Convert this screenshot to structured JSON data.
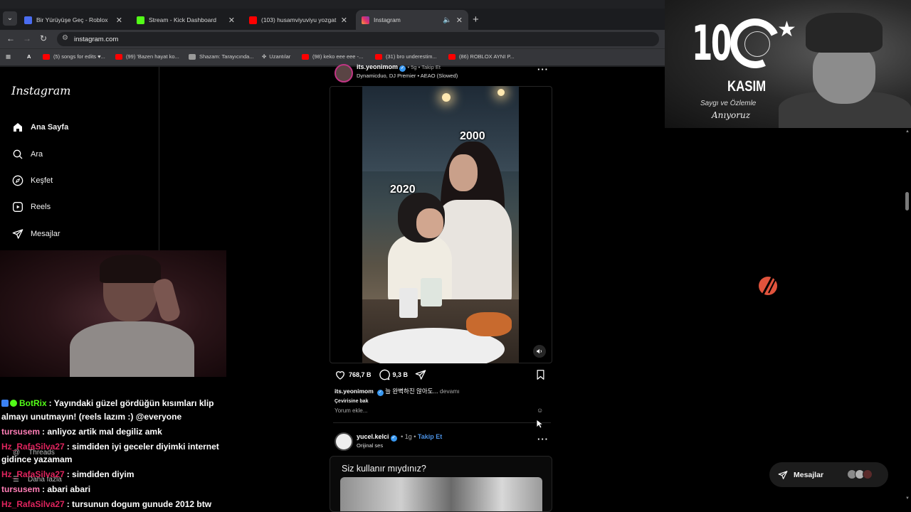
{
  "browser": {
    "tabs": [
      {
        "title": "Bir Yürüyüşe Geç - Roblox",
        "favicon_color": "#4a6cf0",
        "close": "✕"
      },
      {
        "title": "Stream - Kick Dashboard",
        "favicon_color": "#53fc18",
        "close": "✕"
      },
      {
        "title": "(103) husamviyuviyu yozgat - Y",
        "favicon_color": "#ff0000",
        "close": "✕"
      },
      {
        "title": "Instagram",
        "favicon_color": "#e1306c",
        "close": "✕",
        "active": true,
        "audio": "🔈"
      }
    ],
    "new_tab": "+",
    "url": "instagram.com",
    "bookmarks": [
      {
        "label": "A",
        "color": "#3b6ad6"
      },
      {
        "label": "(5) songs for edits ♥...",
        "color": "#ff0000"
      },
      {
        "label": "(99) 'Bazen hayat ko...",
        "color": "#ff0000"
      },
      {
        "label": "Shazam: Tarayıcında...",
        "color": "#9a9a9a"
      },
      {
        "label": "Uzantılar",
        "color": "#9a9a9a"
      },
      {
        "label": "(98) keko eee eee -...",
        "color": "#ff0000"
      },
      {
        "label": "(31) bro underestim...",
        "color": "#ff0000"
      },
      {
        "label": "(86) ROBLOX AYNI P...",
        "color": "#ff0000"
      }
    ]
  },
  "instagram": {
    "logo": "Instagram",
    "nav": [
      {
        "label": "Ana Sayfa",
        "icon": "home-icon"
      },
      {
        "label": "Ara",
        "icon": "search-icon"
      },
      {
        "label": "Keşfet",
        "icon": "compass-icon"
      },
      {
        "label": "Reels",
        "icon": "reels-icon"
      },
      {
        "label": "Mesajlar",
        "icon": "send-icon"
      }
    ],
    "threads_label": "Threads",
    "more_label": "Daha fazla"
  },
  "chat": [
    {
      "user": "BotRix",
      "user_color": "#53fc18",
      "text": ": Yayındaki güzel gördüğün kısımları klip",
      "badges": true
    },
    {
      "user": "",
      "user_color": "#ffffff",
      "text": "almayı unutmayın! (reels lazım :) @everyone",
      "badges": false
    },
    {
      "user": "tursusem",
      "user_color": "#ff7eb6",
      "text": ": anliyoz artik mal degiliz amk",
      "badges": false
    },
    {
      "user": "Hz_RafaSilva27",
      "user_color": "#e0245e",
      "text": ": simdiden iyi geceler diyimki internet",
      "badges": false
    },
    {
      "user": "",
      "user_color": "#ffffff",
      "text": "gidince yazamam",
      "badges": false
    },
    {
      "user": "Hz_RafaSilva27",
      "user_color": "#e0245e",
      "text": ": simdiden diyim",
      "badges": false
    },
    {
      "user": "tursusem",
      "user_color": "#ff7eb6",
      "text": ": abari abari",
      "badges": false
    },
    {
      "user": "Hz_RafaSilva27",
      "user_color": "#e0245e",
      "text": ": tursunun dogum gunude 2012 btw",
      "badges": false
    }
  ],
  "post1": {
    "username": "its.yeonimom",
    "meta": "• 5g • Takip Et",
    "audio": "Dynamicduo, DJ Premier • AEAO (Slowed)",
    "overlay_top": "2000",
    "overlay_bottom": "2020",
    "likes": "768,7 B",
    "comments": "9,3 B",
    "caption": "늘 완벽하진 않아도...",
    "caption_more": "devamı",
    "translate": "Çevirisine bak",
    "comment_placeholder": "Yorum ekle...",
    "emoji": "☺"
  },
  "post2": {
    "username": "yucel.kelci",
    "time": "1g",
    "follow": "Takip Et",
    "audio": "Orijinal ses",
    "question": "Siz kullanır mıydınız?"
  },
  "overlay": {
    "number": "10",
    "month": "KASIM",
    "subtitle": "Saygı ve Özlemle",
    "signature": "Anıyoruz"
  },
  "messages_pill": {
    "label": "Mesajlar"
  }
}
